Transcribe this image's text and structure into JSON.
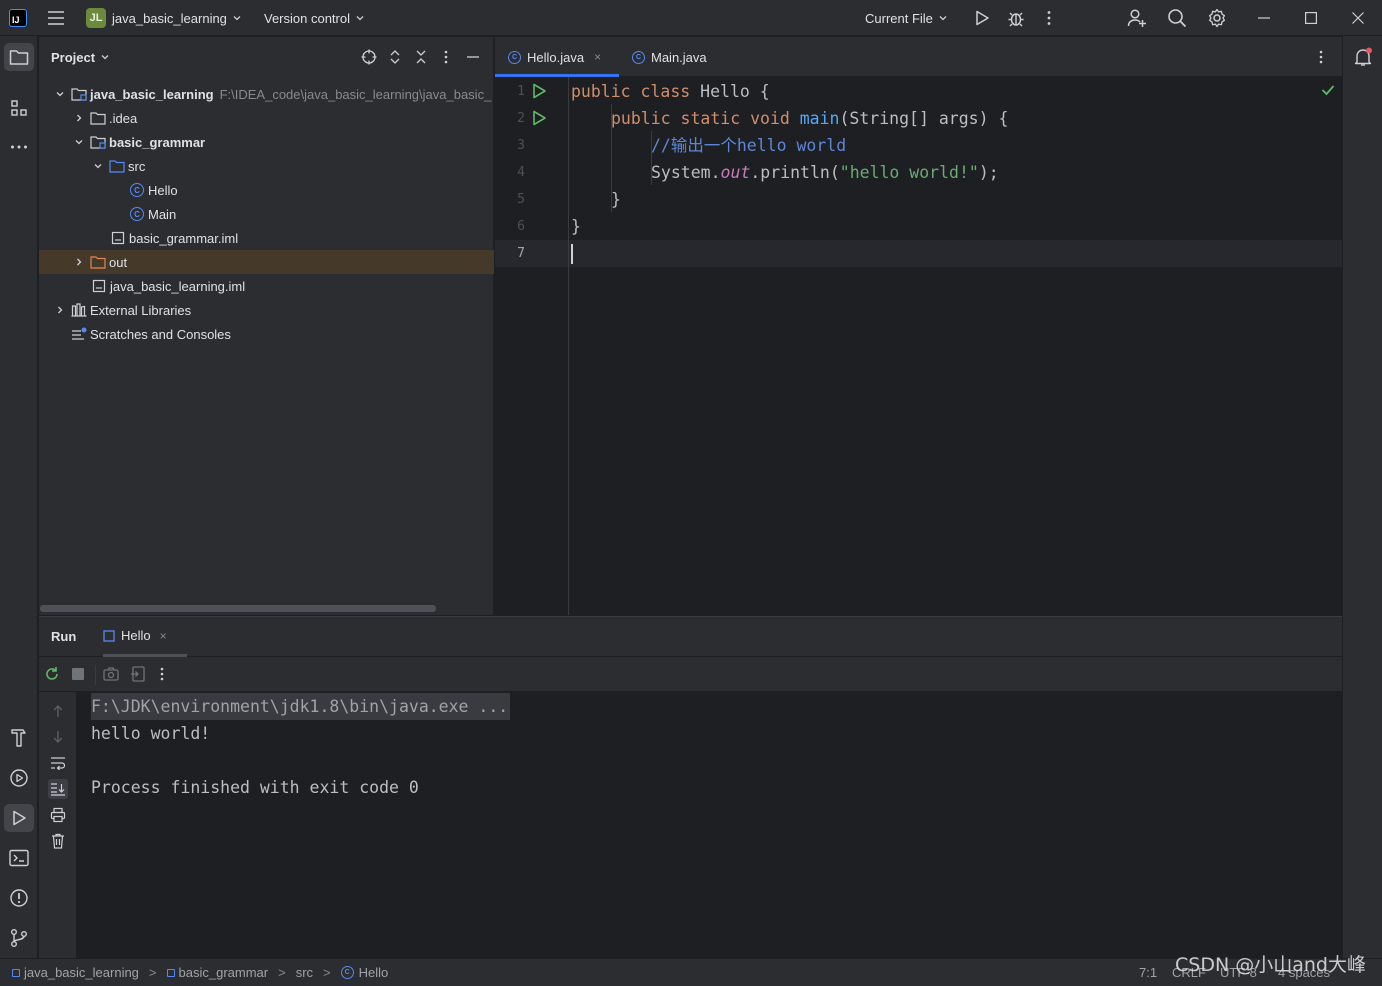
{
  "titlebar": {
    "logo": "IJ",
    "project_badge": "JL",
    "project_name": "java_basic_learning",
    "vcs": "Version control",
    "run_config": "Current File",
    "icons": [
      "hamburger-menu-icon",
      "run-icon",
      "debug-icon",
      "more-vertical-icon",
      "add-user-icon",
      "search-icon",
      "gear-icon",
      "minimize-icon",
      "maximize-icon",
      "close-icon"
    ]
  },
  "project_panel": {
    "title": "Project",
    "tree": [
      {
        "label": "java_basic_learning",
        "path": "F:\\IDEA_code\\java_basic_learning\\java_basic_",
        "type": "module"
      },
      {
        "label": ".idea",
        "type": "folder"
      },
      {
        "label": "basic_grammar",
        "type": "module"
      },
      {
        "label": "src",
        "type": "source-folder"
      },
      {
        "label": "Hello",
        "type": "class"
      },
      {
        "label": "Main",
        "type": "class"
      },
      {
        "label": "basic_grammar.iml",
        "type": "file"
      },
      {
        "label": "out",
        "type": "folder-excluded"
      },
      {
        "label": "java_basic_learning.iml",
        "type": "file"
      },
      {
        "label": "External Libraries",
        "type": "library"
      },
      {
        "label": "Scratches and Consoles",
        "type": "scratches"
      }
    ]
  },
  "editor": {
    "tabs": [
      {
        "label": "Hello.java",
        "close": "×",
        "active": true
      },
      {
        "label": "Main.java",
        "active": false
      }
    ],
    "line_numbers": [
      "1",
      "2",
      "3",
      "4",
      "5",
      "6",
      "7"
    ],
    "code": {
      "l1_kw": "public class",
      "l1_rest": " Hello {",
      "l2_kw": "public static void",
      "l2_fn": "main",
      "l2_rest": "(String[] args) {",
      "l3_comment": "//输出一个hello world",
      "l4_a": "System.",
      "l4_out": "out",
      "l4_b": ".println(",
      "l4_str": "\"hello world!\"",
      "l4_c": ");",
      "l5": "}",
      "l6": "}"
    }
  },
  "run_panel": {
    "title": "Run",
    "tab_label": "Hello",
    "tab_close": "×",
    "console": {
      "cmd": "F:\\JDK\\environment\\jdk1.8\\bin\\java.exe ...",
      "out1": "hello world!",
      "out2": "",
      "out3": "Process finished with exit code 0"
    }
  },
  "statusbar": {
    "crumbs": [
      "java_basic_learning",
      "basic_grammar",
      "src",
      "Hello"
    ],
    "separator": ">",
    "position": "7:1",
    "line_sep": "CRLF",
    "encoding": "UTF-8",
    "indent": "4 spaces"
  },
  "watermark": "CSDN @小山and大峰",
  "colors": {
    "accent": "#3574f0",
    "keyword": "#cf8e6d",
    "function": "#56a8f5",
    "string": "#6aab73",
    "comment": "#5f86d6",
    "static_field": "#c77dbb",
    "run_green": "#5fb865"
  }
}
